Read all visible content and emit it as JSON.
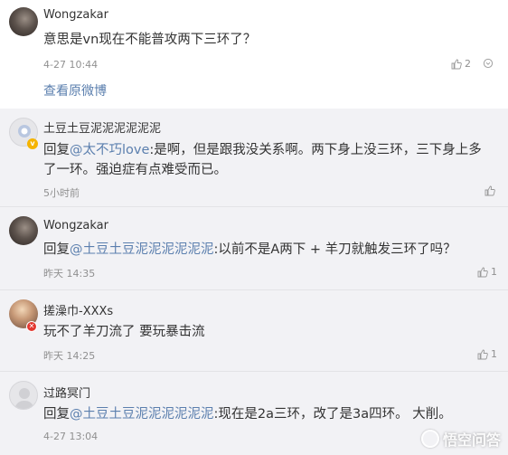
{
  "main_comment": {
    "username": "Wongzakar",
    "text": "意思是vn现在不能普攻两下三环了？",
    "timestamp": "4-27 10:44",
    "like_count": "2",
    "view_original": "查看原微博"
  },
  "replies": [
    {
      "username": "土豆土豆泥泥泥泥泥泥",
      "prefix": "回复",
      "mention": "@太不巧love",
      "text_line1": ":是啊，但是跟我没关系啊。两下身上没三环，三下身上多",
      "text_line2": "了一环。强迫症有点难受而已。",
      "timestamp": "5小时前",
      "like_count": ""
    },
    {
      "username": "Wongzakar",
      "prefix": "回复",
      "mention": "@土豆土豆泥泥泥泥泥泥",
      "text": ":以前不是A两下 + 羊刀就触发三环了吗？",
      "timestamp": "昨天 14:35",
      "like_count": "1"
    },
    {
      "username": "搓澡巾-XXXs",
      "text": "玩不了羊刀流了 要玩暴击流",
      "timestamp": "昨天 14:25",
      "like_count": "1"
    },
    {
      "username": "过路冥门",
      "prefix": "回复",
      "mention": "@土豆土豆泥泥泥泥泥泥",
      "text": ":现在是2a三环，改了是3a四环。 大削。",
      "timestamp": "4-27 13:04",
      "like_count": ""
    }
  ],
  "watermark": "悟空问答",
  "colors": {
    "link": "#5b7fae",
    "meta": "#909090",
    "reply_bg": "#f2f2f5"
  }
}
